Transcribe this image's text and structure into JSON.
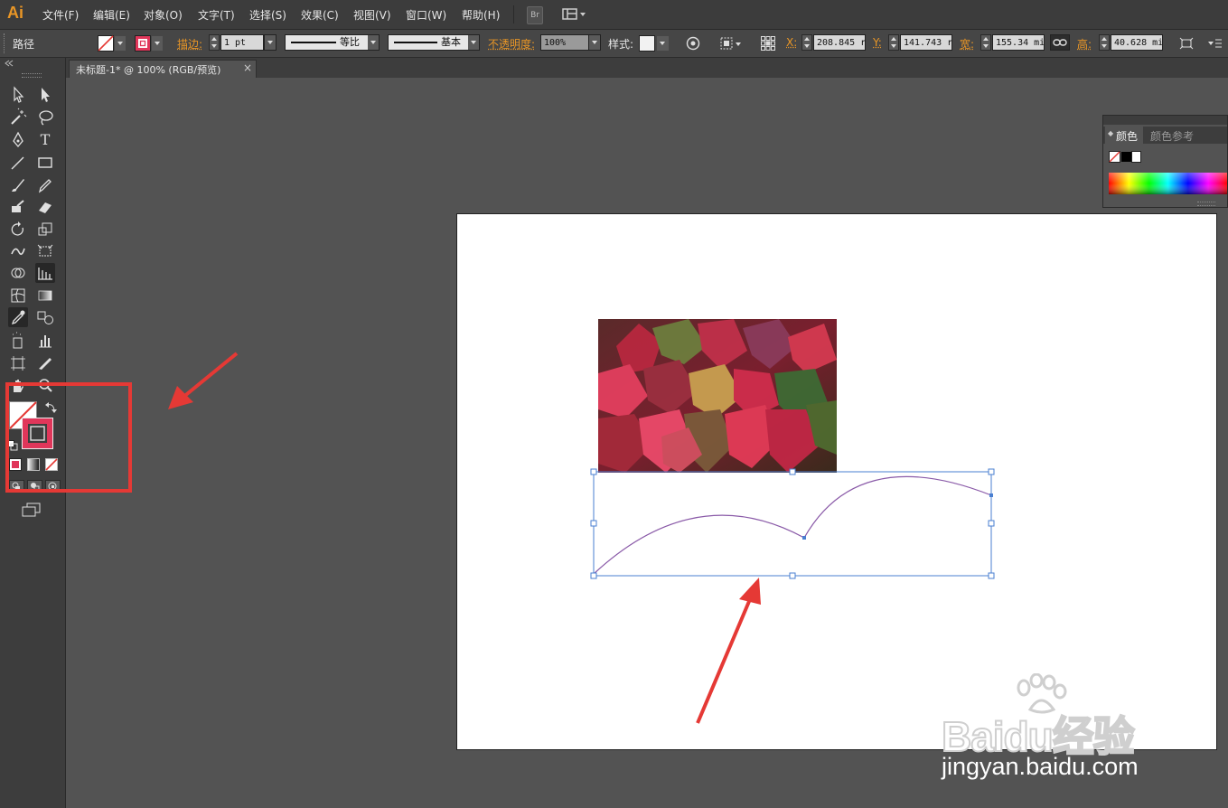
{
  "app": {
    "logo": "Ai"
  },
  "menu": [
    "文件(F)",
    "编辑(E)",
    "对象(O)",
    "文字(T)",
    "选择(S)",
    "效果(C)",
    "视图(V)",
    "窗口(W)",
    "帮助(H)"
  ],
  "menubar_buttons": {
    "bridge": "Br"
  },
  "controlbar": {
    "selection_type": "路径",
    "stroke_label": "描边:",
    "stroke_weight": "1 pt",
    "profile": "等比",
    "brush": "基本",
    "opacity_label": "不透明度:",
    "opacity": "100%",
    "style_label": "样式:",
    "x_label": "X:",
    "x": "208.845 r",
    "y_label": "Y:",
    "y": "141.743 r",
    "w_label": "宽:",
    "w": "155.34 mi",
    "h_label": "高:",
    "h": "40.628 mi"
  },
  "document": {
    "tab_title": "未标题-1* @ 100% (RGB/预览)",
    "close": "×"
  },
  "color_panel": {
    "tab_color": "颜色",
    "tab_guide": "颜色参考"
  },
  "colors": {
    "accent": "#e99626",
    "stroke_swatch": "#e0365a",
    "annotation_red": "#e53935",
    "path_stroke": "#8a5aa8",
    "selection_blue": "#4a7fd1"
  },
  "watermark": {
    "brand": "Baidu经验",
    "url": "jingyan.baidu.com"
  }
}
